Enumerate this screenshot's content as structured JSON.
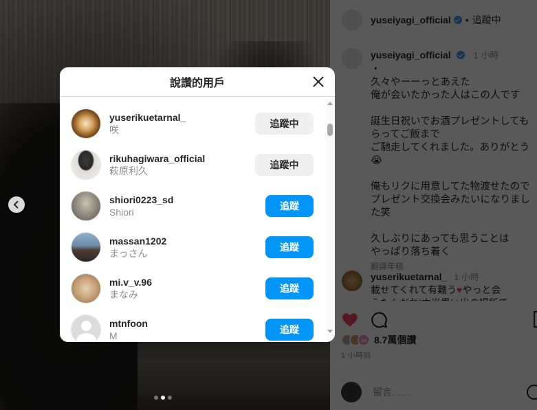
{
  "post": {
    "author": "yuseiyagi_official",
    "follow_state": "追蹤中",
    "separator": "•",
    "caption_time": "1 小時",
    "caption_text": "・\n久々やーーっとあえた\n俺が会いたかった人はこの人です\n\n誕生日祝いでお酒プレゼントしてもらってご飯まで\nご馳走してくれました。ありがとう😭\n\n俺もリクに用意してた物渡せたのでプレゼント交換会みたいになりました笑\n\n久しぶりにあっても思うことは\nやっぱり落ち着く",
    "translate_label": "翻譯年糕",
    "comment": {
      "user": "yuserikuetarnal_",
      "time": "1 小時",
      "text_before": "載せてくれて有難う",
      "heart": "♥",
      "text_after": "やっと会",
      "text_line2": "えたんだね!本当思い出の場所で"
    },
    "likes_badge": "as",
    "likes_count": "8.7萬個讚",
    "posted_ago": "1 小時前",
    "comment_placeholder": "留言……"
  },
  "modal": {
    "title": "說讚的用戶",
    "users": [
      {
        "handle": "yuserikuetarnal_",
        "fullname": "咲",
        "button": "追蹤中",
        "following": true,
        "avatar": "coffee-art-avatar"
      },
      {
        "handle": "rikuhagiwara_official",
        "fullname": "萩原利久",
        "button": "追蹤中",
        "following": true,
        "avatar": "portrait-avatar"
      },
      {
        "handle": "shiori0223_sd",
        "fullname": "Shiori",
        "button": "追蹤",
        "following": false,
        "avatar": "portrait-avatar"
      },
      {
        "handle": "massan1202",
        "fullname": "まっさん",
        "button": "追蹤",
        "following": false,
        "avatar": "outdoor-avatar"
      },
      {
        "handle": "mi.v_v.96",
        "fullname": "まなみ",
        "button": "追蹤",
        "following": false,
        "avatar": "pet-avatar"
      },
      {
        "handle": "mtnfoon",
        "fullname": "M",
        "button": "追蹤",
        "following": false,
        "avatar": "default-avatar"
      }
    ]
  },
  "colors": {
    "follow_blue": "#0095f6",
    "following_gray": "#efefef",
    "like_red": "#ed4956",
    "verified_blue": "#3897f0"
  }
}
